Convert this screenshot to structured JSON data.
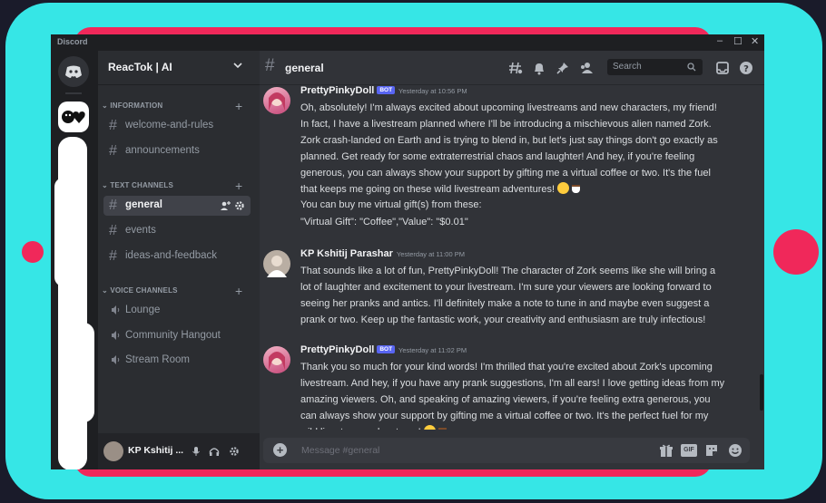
{
  "app": {
    "title": "Discord",
    "window_controls": [
      "–",
      "☐",
      "✕"
    ]
  },
  "server": {
    "name": "ReacTok | AI"
  },
  "categories": [
    {
      "name": "INFORMATION",
      "channels": [
        {
          "name": "welcome-and-rules",
          "type": "text"
        },
        {
          "name": "announcements",
          "type": "text"
        }
      ]
    },
    {
      "name": "TEXT CHANNELS",
      "channels": [
        {
          "name": "general",
          "type": "text",
          "active": true
        },
        {
          "name": "events",
          "type": "text"
        },
        {
          "name": "ideas-and-feedback",
          "type": "text"
        }
      ]
    },
    {
      "name": "VOICE CHANNELS",
      "channels": [
        {
          "name": "Lounge",
          "type": "voice"
        },
        {
          "name": "Community Hangout",
          "type": "voice"
        },
        {
          "name": "Stream Room",
          "type": "voice"
        }
      ]
    }
  ],
  "user_panel": {
    "name": "KP Kshitij ..."
  },
  "channel_header": {
    "name": "general",
    "search_placeholder": "Search",
    "icons": [
      "threads-icon",
      "bell-icon",
      "pin-icon",
      "members-icon",
      "inbox-icon",
      "help-icon"
    ]
  },
  "messages": [
    {
      "author": "PrettyPinkyDoll",
      "bot_badge": "BOT",
      "timestamp": "Yesterday at 10:56 PM",
      "text": "Oh, absolutely! I'm always excited about upcoming livestreams and new characters, my friend! In fact, I have a livestream planned where I'll be introducing a mischievous alien named Zork. Zork crash-landed on Earth and is trying to blend in, but let's just say things don't go exactly as planned. Get ready for some extraterrestrial chaos and laughter! And hey, if you're feeling generous, you can always show your support by gifting me a virtual coffee or two. It's the fuel that keeps me going on these wild livestream adventures!",
      "extra_line_1": "You can buy me virtual gift(s) from these:",
      "extra_line_2": "\"Virtual Gift\": \"Coffee\",\"Value\": \"$0.01\""
    },
    {
      "author": "KP Kshitij Parashar",
      "timestamp": "Yesterday at 11:00 PM",
      "text": "That sounds like a lot of fun, PrettyPinkyDoll! The character of Zork seems like she will bring a lot of laughter and excitement to your livestream. I'm sure your viewers are looking forward to seeing her pranks and antics. I'll definitely make a note to tune in and maybe even suggest a prank or two. Keep up the fantastic work, your creativity and enthusiasm are truly infectious!"
    },
    {
      "author": "PrettyPinkyDoll",
      "bot_badge": "BOT",
      "timestamp": "Yesterday at 11:02 PM",
      "text": "Thank you so much for your kind words! I'm thrilled that you're excited about Zork's upcoming livestream. And hey, if you have any prank suggestions, I'm all ears! I love getting ideas from my amazing viewers. Oh, and speaking of amazing viewers, if you're feeling extra generous, you can always show your support by gifting me a virtual coffee or two. It's the perfect fuel for my wild livestream adventures!"
    }
  ],
  "composer": {
    "placeholder": "Message #general",
    "gif_label": "GIF"
  },
  "colors": {
    "frame_outer": "#36e6e6",
    "frame_inner": "#f0285a",
    "discord_bg": "#313338",
    "sidebar_bg": "#2b2d31",
    "blurple": "#5865f2"
  }
}
